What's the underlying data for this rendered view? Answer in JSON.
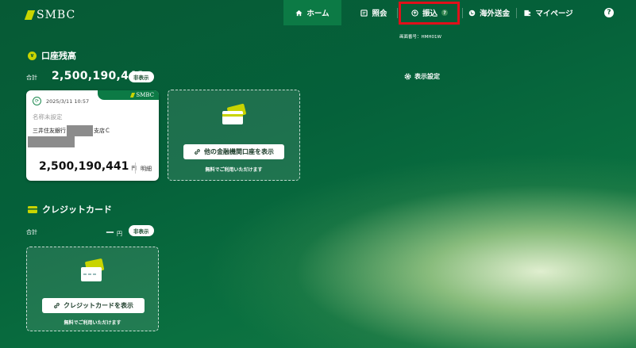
{
  "header": {
    "brand": "SMBC",
    "nav": [
      {
        "label": "ホーム",
        "icon": "home-icon"
      },
      {
        "label": "照会",
        "icon": "document-icon"
      },
      {
        "label": "振込",
        "icon": "transfer-icon",
        "badge": "?"
      },
      {
        "label": "海外送金",
        "icon": "globe-icon"
      },
      {
        "label": "マイページ",
        "icon": "profile-icon"
      }
    ],
    "help": "?",
    "screen_id": "画面番号：HMH01W",
    "highlight_color": "#e0101a"
  },
  "accounts": {
    "title": "口座残高",
    "total_label": "合計",
    "total_amount": "2,500,190,441",
    "currency": "円",
    "hide_label": "非表示",
    "display_settings": "表示設定",
    "card": {
      "date": "2025/3/11 10:57",
      "brand": "SMBC",
      "name": "名称未設定",
      "bank": "三井住友銀行",
      "branch": "支店Ｃ",
      "amount": "2,500,190,441",
      "currency": "円",
      "detail_link": "明細"
    },
    "other": {
      "button": "他の金融機関口座を表示",
      "note": "無料でご利用いただけます"
    }
  },
  "credit": {
    "title": "クレジットカード",
    "total_label": "合計",
    "total_amount": "ー",
    "currency": "円",
    "hide_label": "非表示",
    "button": "クレジットカードを表示",
    "note": "無料でご利用いただけます"
  },
  "colors": {
    "background": "#065a35",
    "accent": "#c8d400",
    "active_nav": "#0c7a45"
  }
}
